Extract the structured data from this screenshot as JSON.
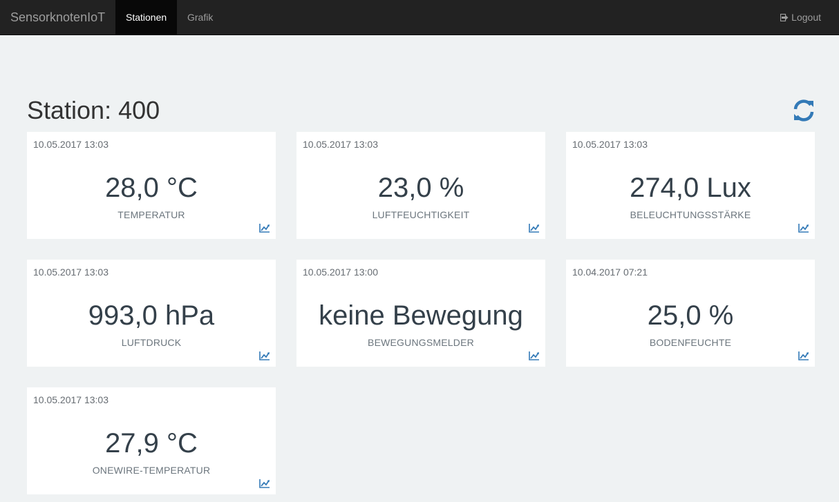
{
  "navbar": {
    "brand": "SensorknotenIoT",
    "tabs": [
      {
        "label": "Stationen",
        "active": true
      },
      {
        "label": "Grafik",
        "active": false
      }
    ],
    "logout_label": "Logout",
    "logout_icon": "logout-icon"
  },
  "page": {
    "title": "Station: 400",
    "refresh_icon": "refresh-icon",
    "accent_color": "#337ab7"
  },
  "cards": [
    {
      "timestamp": "10.05.2017 13:03",
      "value": "28,0 °C",
      "label": "TEMPERATUR",
      "icon": "line-chart-icon"
    },
    {
      "timestamp": "10.05.2017 13:03",
      "value": "23,0 %",
      "label": "LUFTFEUCHTIGKEIT",
      "icon": "line-chart-icon"
    },
    {
      "timestamp": "10.05.2017 13:03",
      "value": "274,0 Lux",
      "label": "BELEUCHTUNGSSTÄRKE",
      "icon": "line-chart-icon"
    },
    {
      "timestamp": "10.05.2017 13:03",
      "value": "993,0 hPa",
      "label": "LUFTDRUCK",
      "icon": "line-chart-icon"
    },
    {
      "timestamp": "10.05.2017 13:00",
      "value": "keine Bewegung",
      "label": "BEWEGUNGSMELDER",
      "icon": "line-chart-icon"
    },
    {
      "timestamp": "10.04.2017 07:21",
      "value": "25,0 %",
      "label": "BODENFEUCHTE",
      "icon": "line-chart-icon"
    },
    {
      "timestamp": "10.05.2017 13:03",
      "value": "27,9 °C",
      "label": "ONEWIRE-TEMPERATUR",
      "icon": "line-chart-icon"
    }
  ]
}
